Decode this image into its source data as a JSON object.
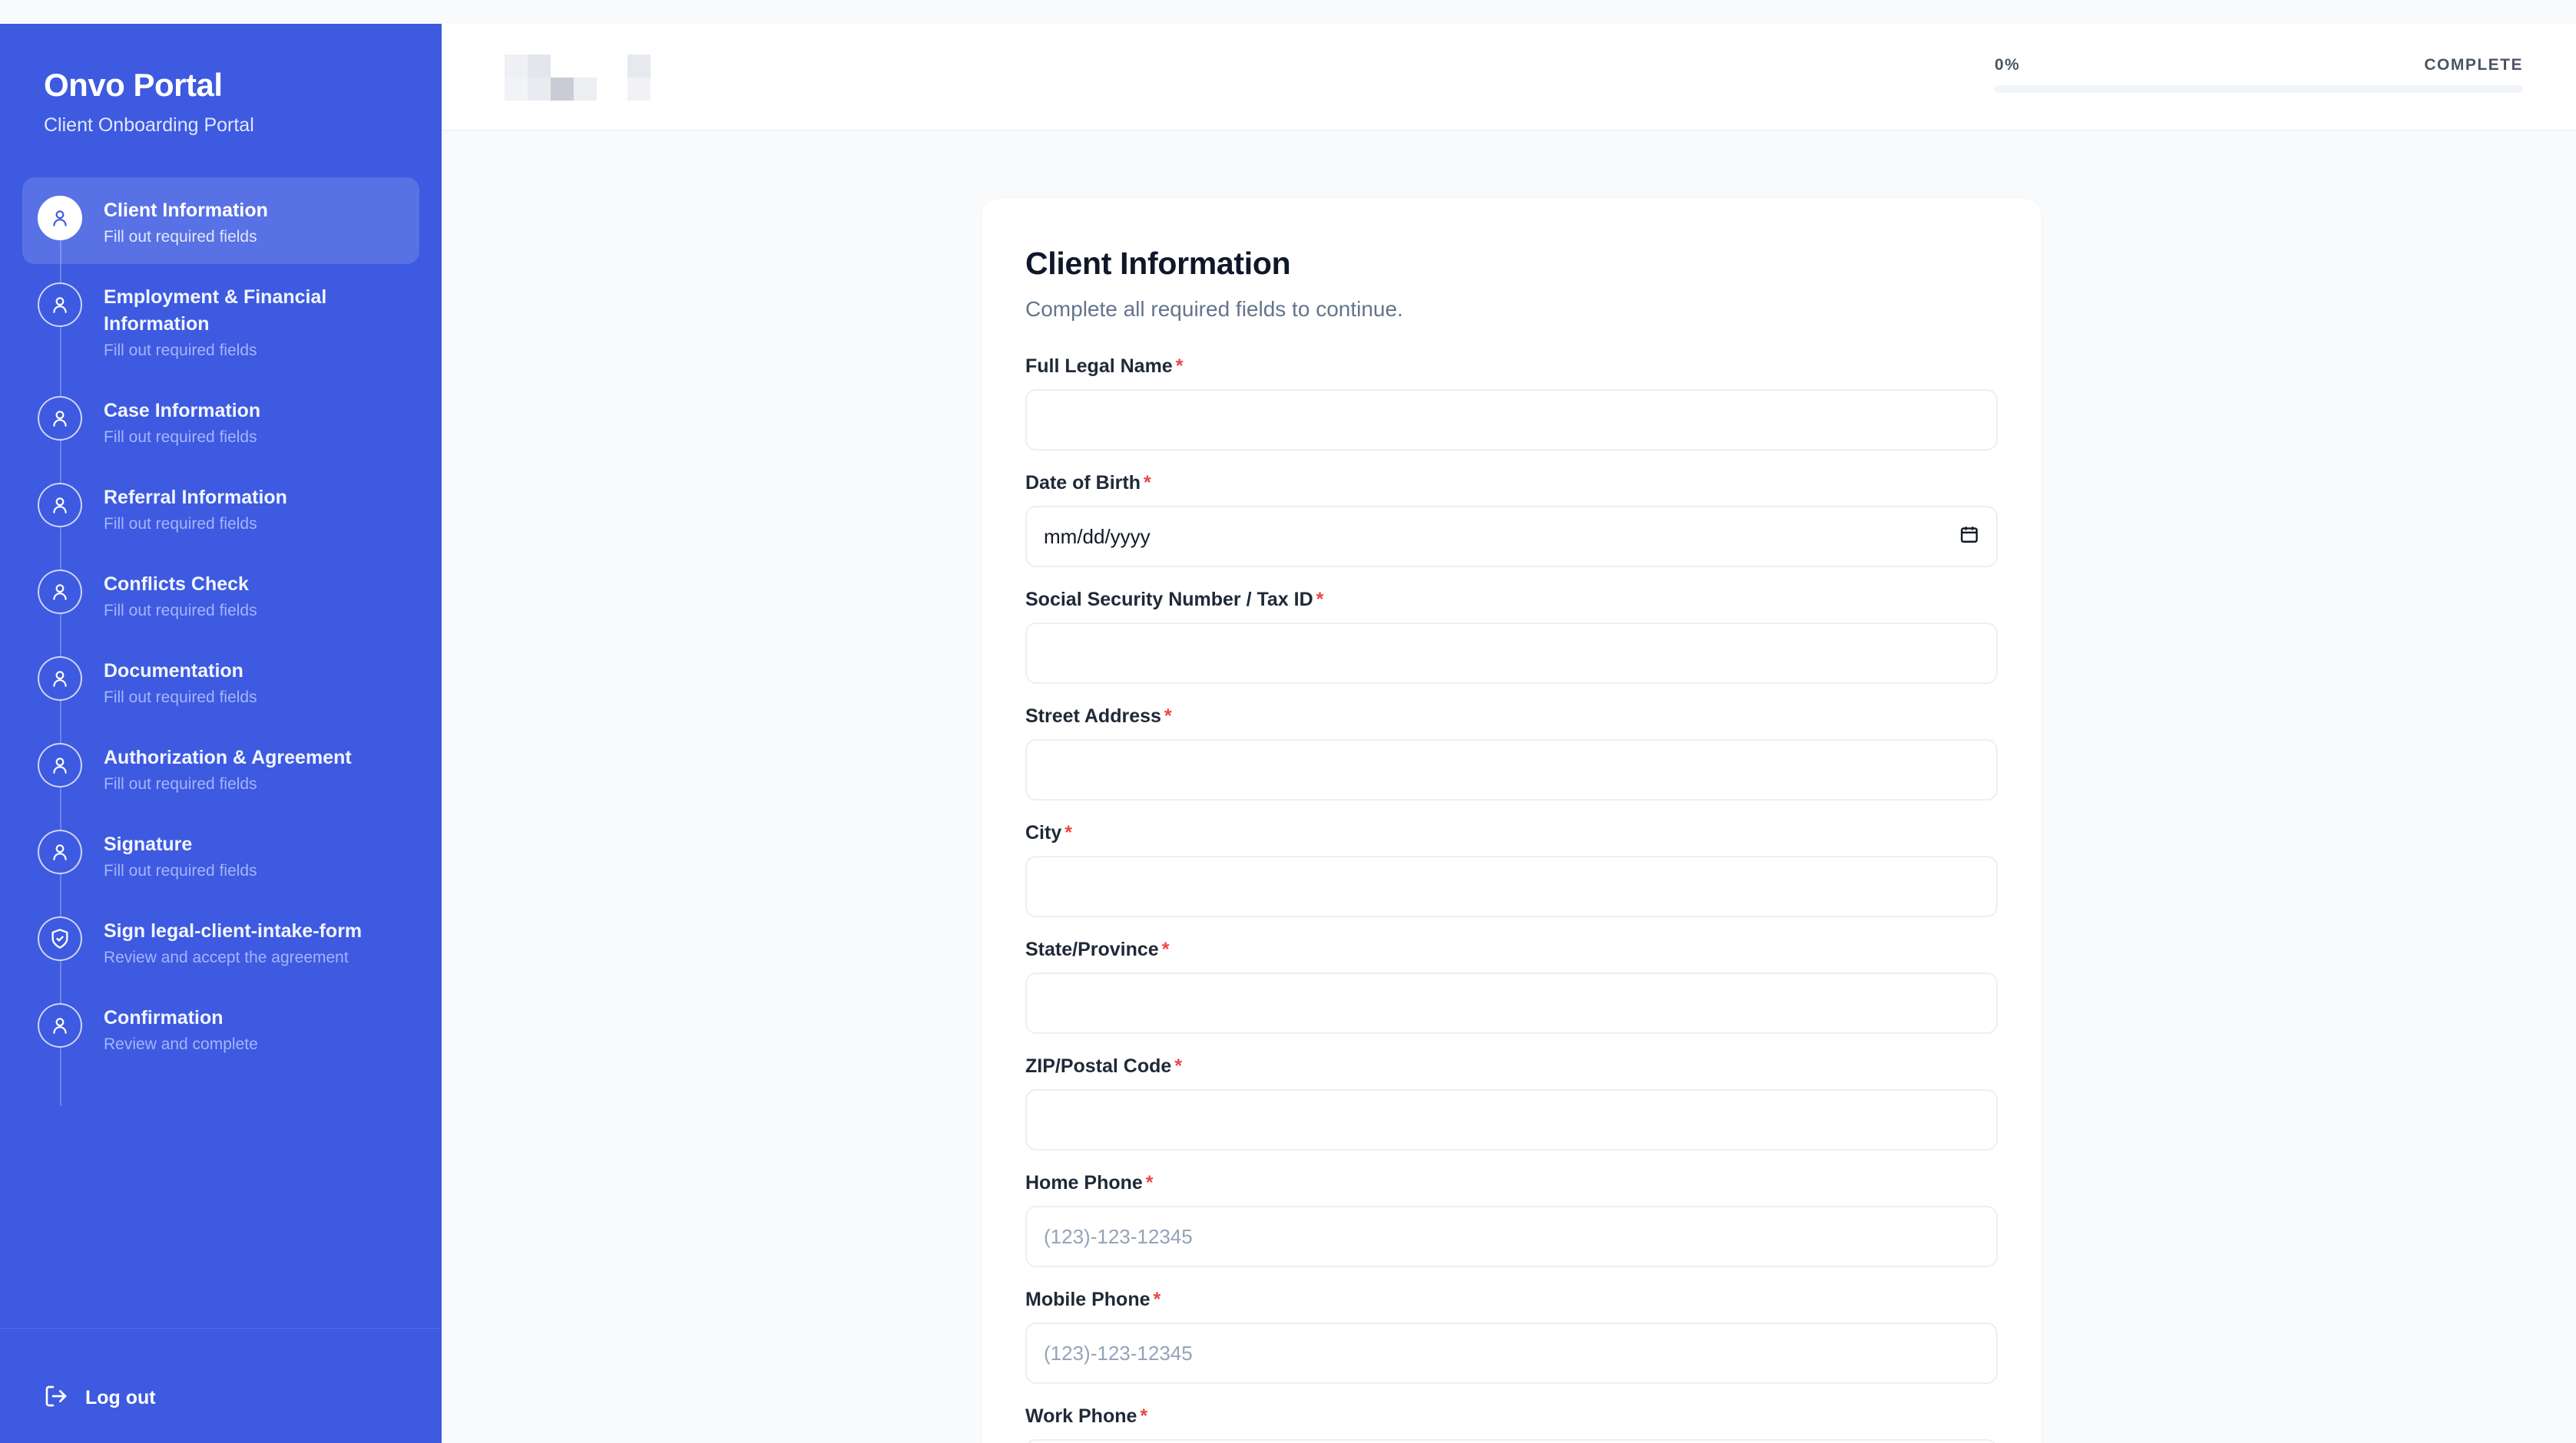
{
  "sidebar": {
    "brand_title": "Onvo Portal",
    "brand_subtitle": "Client Onboarding Portal",
    "steps": [
      {
        "title": "Client Information",
        "desc": "Fill out required fields",
        "icon": "user-icon",
        "active": true
      },
      {
        "title": "Employment & Financial Information",
        "desc": "Fill out required fields",
        "icon": "user-icon",
        "active": false
      },
      {
        "title": "Case Information",
        "desc": "Fill out required fields",
        "icon": "user-icon",
        "active": false
      },
      {
        "title": "Referral Information",
        "desc": "Fill out required fields",
        "icon": "user-icon",
        "active": false
      },
      {
        "title": "Conflicts Check",
        "desc": "Fill out required fields",
        "icon": "user-icon",
        "active": false
      },
      {
        "title": "Documentation",
        "desc": "Fill out required fields",
        "icon": "user-icon",
        "active": false
      },
      {
        "title": "Authorization & Agreement",
        "desc": "Fill out required fields",
        "icon": "user-icon",
        "active": false
      },
      {
        "title": "Signature",
        "desc": "Fill out required fields",
        "icon": "user-icon",
        "active": false
      },
      {
        "title": "Sign legal-client-intake-form",
        "desc": "Review and accept the agreement",
        "icon": "shield-check-icon",
        "active": false
      },
      {
        "title": "Confirmation",
        "desc": "Review and complete",
        "icon": "user-icon",
        "active": false
      }
    ],
    "logout_label": "Log out"
  },
  "header": {
    "progress_percent_label": "0%",
    "progress_value": 0,
    "progress_status": "COMPLETE"
  },
  "form": {
    "title": "Client Information",
    "subtitle": "Complete all required fields to continue.",
    "required_mark": "*",
    "fields": [
      {
        "label": "Full Legal Name",
        "value": "",
        "placeholder": ""
      },
      {
        "label": "Date of Birth",
        "value": "mm/dd/yyyy",
        "placeholder": ""
      },
      {
        "label": "Social Security Number / Tax ID",
        "value": "",
        "placeholder": ""
      },
      {
        "label": "Street Address",
        "value": "",
        "placeholder": ""
      },
      {
        "label": "City",
        "value": "",
        "placeholder": ""
      },
      {
        "label": "State/Province",
        "value": "",
        "placeholder": ""
      },
      {
        "label": "ZIP/Postal Code",
        "value": "",
        "placeholder": ""
      },
      {
        "label": "Home Phone",
        "value": "",
        "placeholder": "(123)-123-12345"
      },
      {
        "label": "Mobile Phone",
        "value": "",
        "placeholder": "(123)-123-12345"
      },
      {
        "label": "Work Phone",
        "value": "",
        "placeholder": ""
      }
    ]
  },
  "colors": {
    "sidebar_bg": "#3d5ae0",
    "required": "#ef4444",
    "accent": "#3d5ae0"
  }
}
